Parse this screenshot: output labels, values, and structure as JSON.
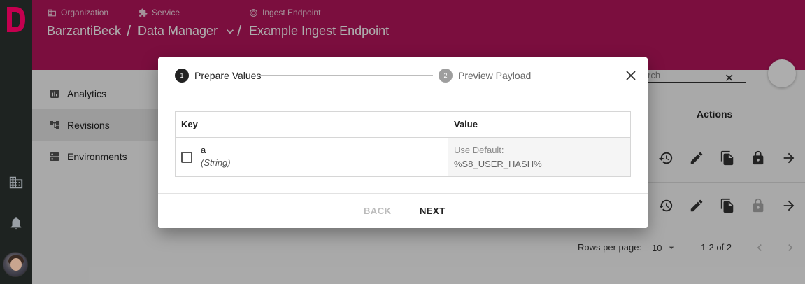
{
  "header": {
    "crumbs": [
      {
        "type": "Organization",
        "name": "BarzantiBeck",
        "icon": "organization-icon"
      },
      {
        "type": "Service",
        "name": "Data Manager",
        "icon": "puzzle-icon"
      },
      {
        "type": "Ingest Endpoint",
        "name": "Example Ingest Endpoint",
        "icon": "ingest-icon"
      }
    ]
  },
  "sidebar": {
    "items": [
      {
        "label": "Analytics",
        "icon": "analytics-icon"
      },
      {
        "label": "Revisions",
        "icon": "revisions-icon"
      },
      {
        "label": "Environments",
        "icon": "environments-icon"
      }
    ]
  },
  "table": {
    "search_placeholder": "rch",
    "actions_header": "Actions",
    "rows_per_page_label": "Rows per page:",
    "rows_per_page_value": "10",
    "range": "1-2 of 2"
  },
  "dialog": {
    "steps": [
      {
        "number": "1",
        "label": "Prepare Values",
        "state": "active"
      },
      {
        "number": "2",
        "label": "Preview Payload",
        "state": "inactive"
      }
    ],
    "columns": {
      "key": "Key",
      "value": "Value"
    },
    "rows": [
      {
        "key": "a",
        "type": "(String)",
        "value_label": "Use Default:",
        "value": "%S8_USER_HASH%"
      }
    ],
    "buttons": {
      "back": "BACK",
      "next": "NEXT"
    }
  },
  "colors": {
    "brand": "#b5155c",
    "rail": "#1e2321"
  }
}
